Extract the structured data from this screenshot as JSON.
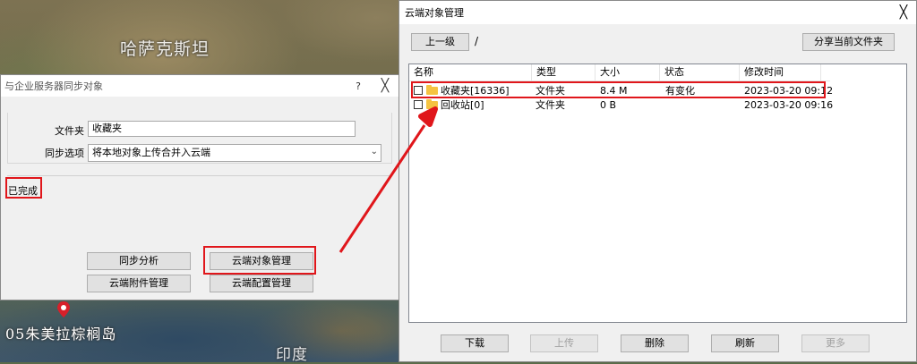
{
  "map": {
    "label_kazakhstan": "哈萨克斯坦",
    "label_india": "印度",
    "label_palm": "05朱美拉棕榈岛"
  },
  "sync_dialog": {
    "title": "与企业服务器同步对象",
    "help_glyph": "?",
    "close_glyph": "╳",
    "folder_label": "文件夹",
    "folder_value": "收藏夹",
    "sync_option_label": "同步选项",
    "sync_option_value": "将本地对象上传合并入云端",
    "status_text": "已完成",
    "buttons": {
      "sync_analysis": "同步分析",
      "cloud_object_mgmt": "云端对象管理",
      "cloud_attachment_mgmt": "云端附件管理",
      "cloud_config_mgmt": "云端配置管理"
    }
  },
  "cloud_dialog": {
    "title": "云端对象管理",
    "close_glyph": "╳",
    "up_button": "上一级",
    "path": "/",
    "share_button": "分享当前文件夹",
    "columns": [
      "名称",
      "类型",
      "大小",
      "状态",
      "修改时间"
    ],
    "rows": [
      {
        "name": "收藏夹[16336]",
        "type": "文件夹",
        "size": "8.4 M",
        "status": "有变化",
        "modified": "2023-03-20 09:12"
      },
      {
        "name": "回收站[0]",
        "type": "文件夹",
        "size": "0 B",
        "status": "",
        "modified": "2023-03-20 09:16"
      }
    ],
    "buttons": {
      "download": "下载",
      "upload": "上传",
      "delete": "删除",
      "refresh": "刷新",
      "more": "更多"
    }
  },
  "colors": {
    "highlight": "#e0161b",
    "folder": "#f5c342"
  }
}
